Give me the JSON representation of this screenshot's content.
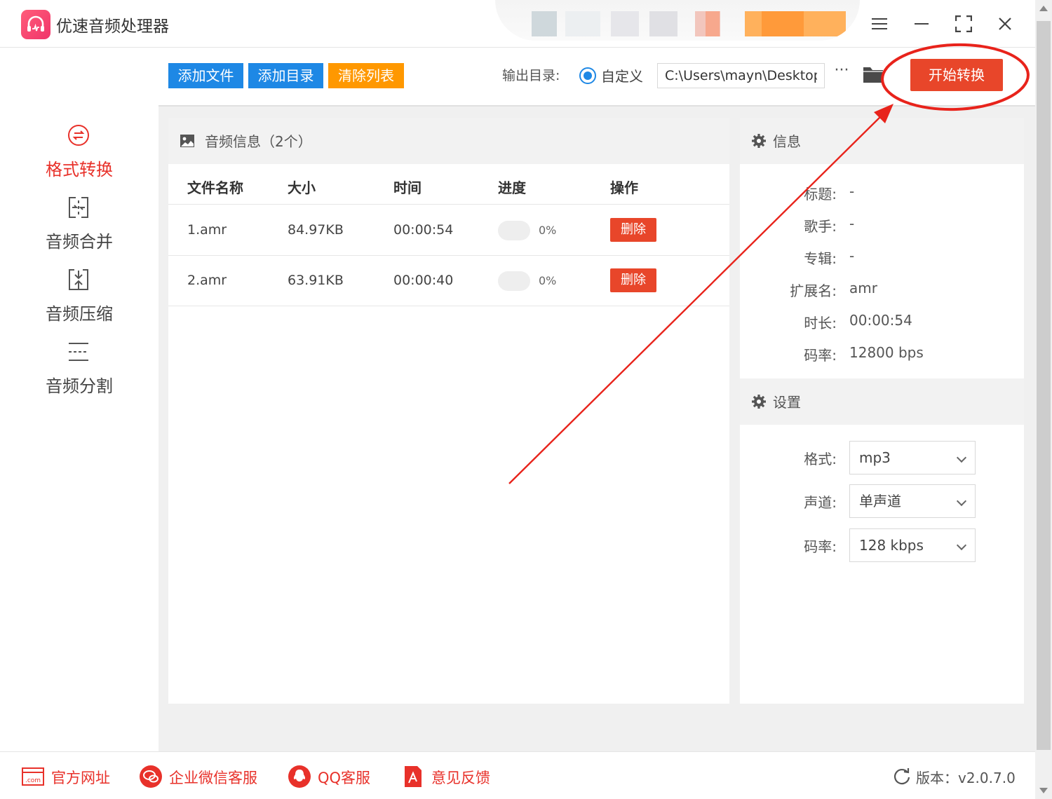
{
  "app": {
    "title": "优速音频处理器"
  },
  "sidebar": {
    "items": [
      {
        "label": "格式转换",
        "icon": "convert-icon",
        "active": true
      },
      {
        "label": "音频合并",
        "icon": "merge-icon",
        "active": false
      },
      {
        "label": "音频压缩",
        "icon": "compress-icon",
        "active": false
      },
      {
        "label": "音频分割",
        "icon": "split-icon",
        "active": false
      }
    ]
  },
  "toolbar": {
    "add_file": "添加文件",
    "add_dir": "添加目录",
    "clear_list": "清除列表",
    "output_label": "输出目录:",
    "radio_label": "自定义",
    "path_value": "C:\\Users\\mayn\\Desktop",
    "more": "···",
    "start": "开始转换",
    "colors": {
      "blue": "#1e88e5",
      "orange": "#ff9800",
      "red": "#e8462a"
    }
  },
  "file_panel": {
    "title": "音频信息（2个）",
    "columns": [
      "文件名称",
      "大小",
      "时间",
      "进度",
      "操作"
    ],
    "rows": [
      {
        "name": "1.amr",
        "size": "84.97KB",
        "time": "00:00:54",
        "progress": 0,
        "progress_text": "0%",
        "action": "删除"
      },
      {
        "name": "2.amr",
        "size": "63.91KB",
        "time": "00:00:40",
        "progress": 0,
        "progress_text": "0%",
        "action": "删除"
      }
    ]
  },
  "info": {
    "title": "信息",
    "fields": [
      {
        "key": "标题:",
        "value": "-"
      },
      {
        "key": "歌手:",
        "value": "-"
      },
      {
        "key": "专辑:",
        "value": "-"
      },
      {
        "key": "扩展名:",
        "value": "amr"
      },
      {
        "key": "时长:",
        "value": "00:00:54"
      },
      {
        "key": "码率:",
        "value": "12800 bps"
      }
    ]
  },
  "settings": {
    "title": "设置",
    "fields": [
      {
        "key": "格式:",
        "value": "mp3"
      },
      {
        "key": "声道:",
        "value": "单声道"
      },
      {
        "key": "码率:",
        "value": "128 kbps"
      }
    ]
  },
  "footer": {
    "items": [
      {
        "label": "官方网址",
        "icon": "website-icon"
      },
      {
        "label": "企业微信客服",
        "icon": "wechat-icon"
      },
      {
        "label": "QQ客服",
        "icon": "qq-icon"
      },
      {
        "label": "意见反馈",
        "icon": "feedback-icon"
      }
    ],
    "version": "版本：v2.0.7.0"
  }
}
